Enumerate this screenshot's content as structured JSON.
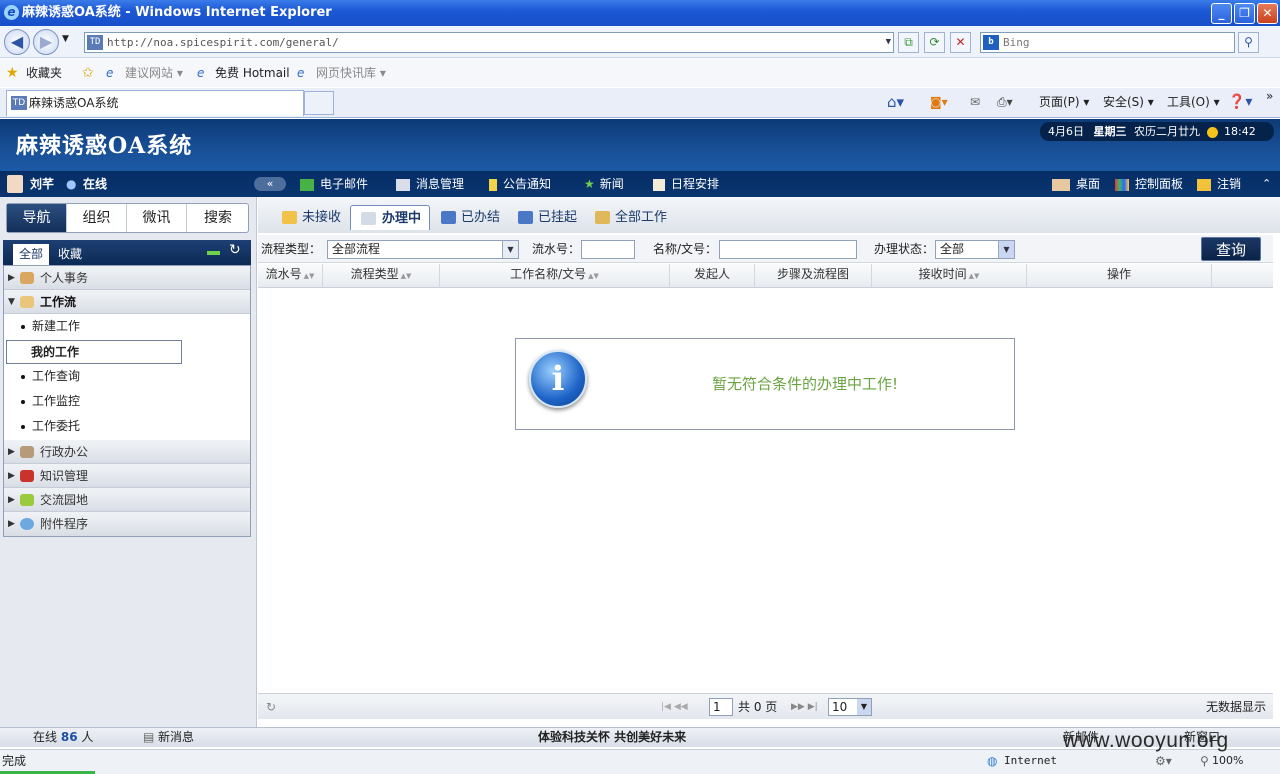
{
  "window": {
    "title": "麻辣诱惑OA系统 - Windows Internet Explorer",
    "min": "_",
    "max": "❐",
    "close": "✕"
  },
  "browser": {
    "url": "http://noa.spicespirit.com/general/",
    "search_placeholder": "Bing",
    "favorites": [
      "收藏夹",
      "建议网站 ▾",
      "免费 Hotmail",
      "网页快讯库 ▾"
    ],
    "tab_title": "麻辣诱惑OA系统",
    "commands": [
      "页面(P) ▾",
      "安全(S) ▾",
      "工具(O) ▾"
    ],
    "status_left": "完成",
    "zone": "Internet",
    "zoom": "100%"
  },
  "oa": {
    "title": "麻辣诱惑OA系统",
    "date": "4月6日",
    "weekday": "星期三",
    "lunar": "农历二月廿九",
    "time": "18:42",
    "user": "刘芊",
    "presence": "在线",
    "menu": [
      "电子邮件",
      "消息管理",
      "公告通知",
      "新闻",
      "日程安排"
    ],
    "right_menu": [
      "桌面",
      "控制面板",
      "注销"
    ]
  },
  "sidebar": {
    "tabs": [
      "导航",
      "组织",
      "微讯",
      "搜索"
    ],
    "subtabs": [
      "全部",
      "收藏"
    ],
    "groups_top": [
      {
        "label": "个人事务",
        "icon": "person-icon"
      },
      {
        "label": "工作流",
        "icon": "workflow-icon"
      }
    ],
    "workflow_items": [
      "新建工作",
      "我的工作",
      "工作查询",
      "工作监控",
      "工作委托"
    ],
    "groups_bottom": [
      {
        "label": "行政办公",
        "icon": "admin-icon"
      },
      {
        "label": "知识管理",
        "icon": "book-icon"
      },
      {
        "label": "交流园地",
        "icon": "chat-icon"
      },
      {
        "label": "附件程序",
        "icon": "globe-icon"
      }
    ]
  },
  "tabs": [
    "未接收",
    "办理中",
    "已办结",
    "已挂起",
    "全部工作"
  ],
  "filter": {
    "type_label": "流程类型：",
    "type_value": "全部流程",
    "serial_label": "流水号：",
    "name_label": "名称/文号：",
    "status_label": "办理状态：",
    "status_value": "全部",
    "query_button": "查询"
  },
  "columns": [
    "流水号",
    "流程类型",
    "工作名称/文号",
    "发起人",
    "步骤及流程图",
    "接收时间",
    "操作"
  ],
  "empty_message": "暂无符合条件的办理中工作!",
  "pager": {
    "page": "1",
    "total_text": "共 0 页",
    "page_size": "10",
    "info": "无数据显示"
  },
  "statusbar": {
    "online_prefix": "在线",
    "online_count": "86",
    "online_suffix": "人",
    "new_msg": "新消息",
    "slogan": "体验科技关怀  共创美好未来",
    "new_mail": "新邮件",
    "new_window": "新窗口"
  },
  "watermark": "www.wooyun.org",
  "colors": {
    "header": "#185096",
    "menubar": "#062d66",
    "message": "#6aa342"
  }
}
